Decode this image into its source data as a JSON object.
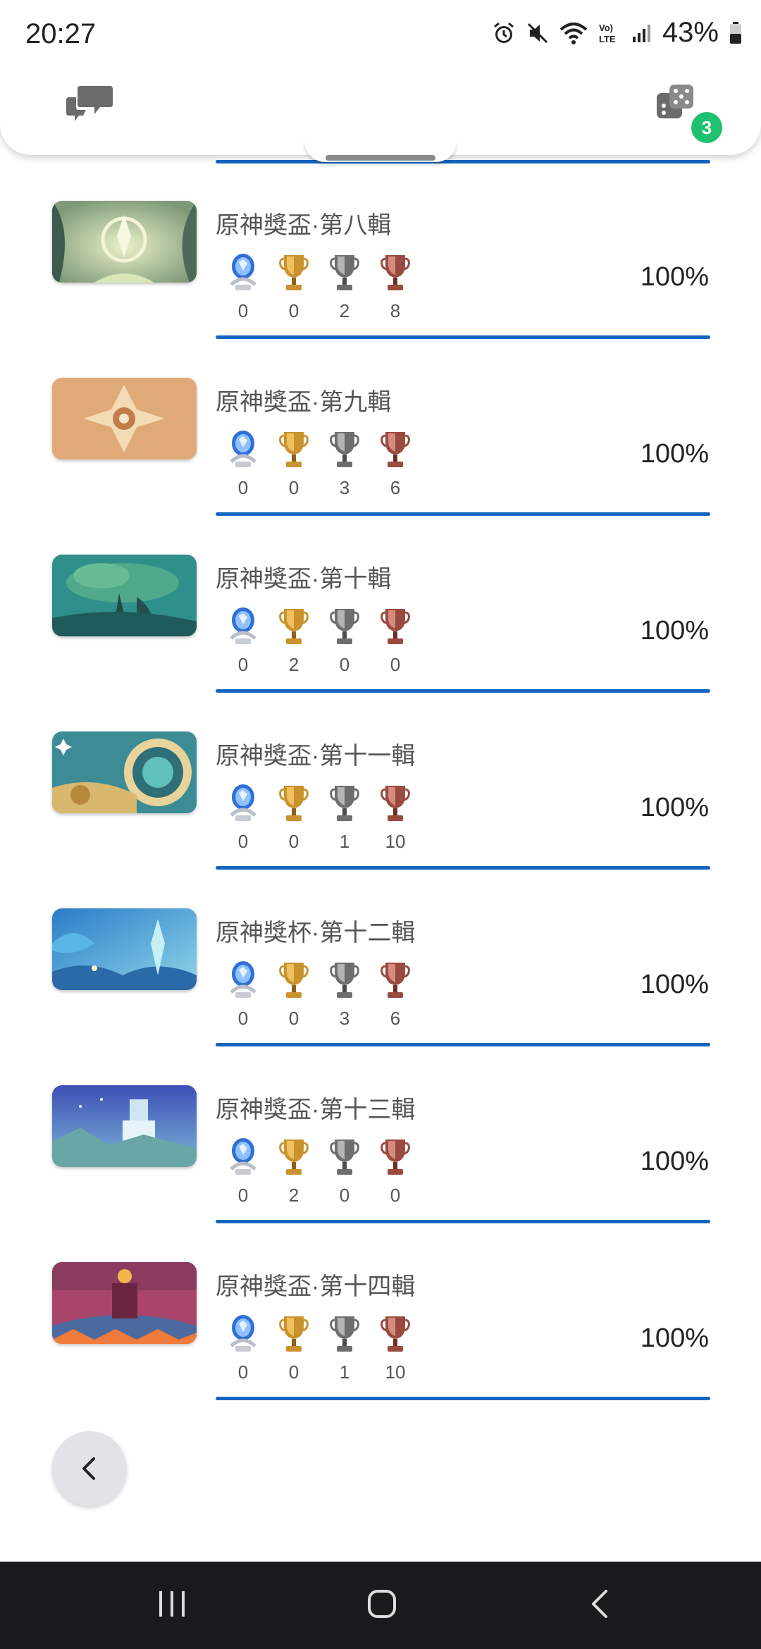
{
  "status_bar": {
    "time": "20:27",
    "battery": "43%"
  },
  "header": {
    "notification_count": "3"
  },
  "rows": [
    {
      "title": "原神獎盃·第八輯",
      "platinum": "0",
      "gold": "0",
      "silver": "2",
      "bronze": "8",
      "percent": "100%",
      "theme": "art-8"
    },
    {
      "title": "原神獎盃·第九輯",
      "platinum": "0",
      "gold": "0",
      "silver": "3",
      "bronze": "6",
      "percent": "100%",
      "theme": "art-9"
    },
    {
      "title": "原神獎盃·第十輯",
      "platinum": "0",
      "gold": "2",
      "silver": "0",
      "bronze": "0",
      "percent": "100%",
      "theme": "art-10"
    },
    {
      "title": "原神獎盃·第十一輯",
      "platinum": "0",
      "gold": "0",
      "silver": "1",
      "bronze": "10",
      "percent": "100%",
      "theme": "art-11"
    },
    {
      "title": "原神獎杯·第十二輯",
      "platinum": "0",
      "gold": "0",
      "silver": "3",
      "bronze": "6",
      "percent": "100%",
      "theme": "art-12"
    },
    {
      "title": "原神獎盃·第十三輯",
      "platinum": "0",
      "gold": "2",
      "silver": "0",
      "bronze": "0",
      "percent": "100%",
      "theme": "art-13"
    },
    {
      "title": "原神獎盃·第十四輯",
      "platinum": "0",
      "gold": "0",
      "silver": "1",
      "bronze": "10",
      "percent": "100%",
      "theme": "art-14"
    }
  ],
  "colors": {
    "accent": "#1565c0",
    "badge": "#1ec26e"
  }
}
